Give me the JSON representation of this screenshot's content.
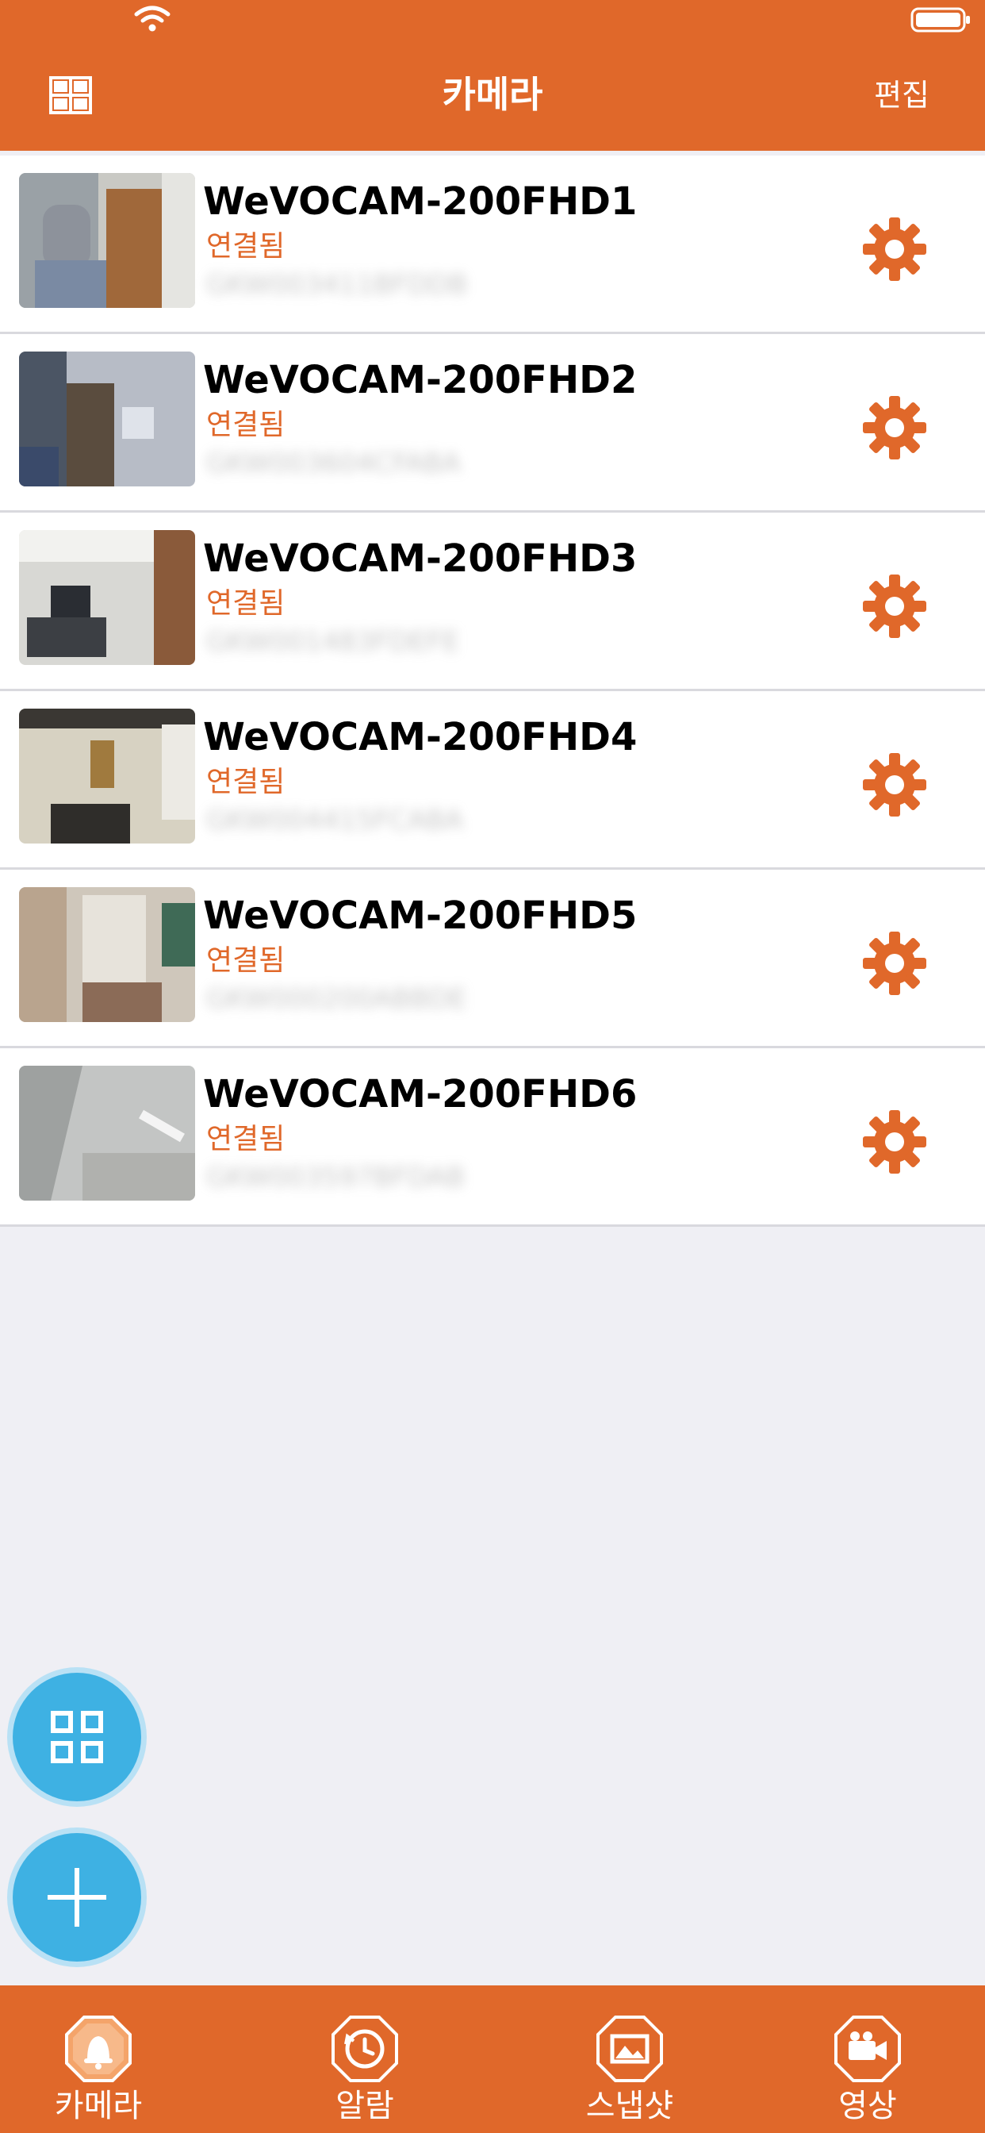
{
  "header": {
    "title": "카메라",
    "edit_label": "편집"
  },
  "colors": {
    "accent": "#e0682a",
    "fab": "#3eb1e3",
    "background": "#efeff4"
  },
  "cameras": [
    {
      "name": "WeVOCAM-200FHD1",
      "status": "연결됨",
      "serial": "GKW003411BFDDB"
    },
    {
      "name": "WeVOCAM-200FHD2",
      "status": "연결됨",
      "serial": "GKW003604CFABA"
    },
    {
      "name": "WeVOCAM-200FHD3",
      "status": "연결됨",
      "serial": "GKW001483FDEFE"
    },
    {
      "name": "WeVOCAM-200FHD4",
      "status": "연결됨",
      "serial": "GKW004415FCABA"
    },
    {
      "name": "WeVOCAM-200FHD5",
      "status": "연결됨",
      "serial": "GKW000200ABBDE"
    },
    {
      "name": "WeVOCAM-200FHD6",
      "status": "연결됨",
      "serial": "GKW003597BFDAB"
    }
  ],
  "fabs": {
    "grid_icon": "grid-view-icon",
    "add_icon": "plus-icon"
  },
  "tabs": [
    {
      "label": "카메라",
      "icon": "bell-icon"
    },
    {
      "label": "알람",
      "icon": "clock-history-icon"
    },
    {
      "label": "스냅샷",
      "icon": "image-icon"
    },
    {
      "label": "영상",
      "icon": "video-camera-icon"
    }
  ]
}
